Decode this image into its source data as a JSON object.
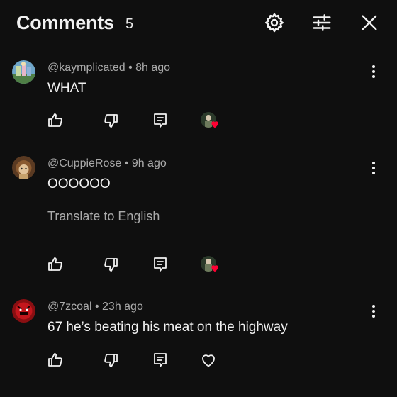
{
  "header": {
    "title": "Comments",
    "count": "5",
    "icons": [
      "gear-icon",
      "sliders-icon",
      "close-icon"
    ]
  },
  "comments": [
    {
      "author": "@kaymplicated",
      "time": "8h ago",
      "text": "WHAT",
      "translate": "",
      "creator_hearted": true
    },
    {
      "author": "@CuppieRose",
      "time": "9h ago",
      "text": "OOOOOO",
      "translate": "Translate to English",
      "creator_hearted": true
    },
    {
      "author": "@7zcoal",
      "time": "23h ago",
      "text": "67 he’s beating his meat on the highway",
      "translate": "",
      "creator_hearted": false
    }
  ],
  "separator": "•",
  "colors": {
    "background": "#0f0f0f",
    "text": "#f1f1f1",
    "secondary_text": "#aaaaaa",
    "heart": "#ff0033"
  }
}
